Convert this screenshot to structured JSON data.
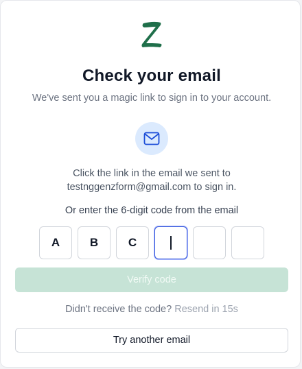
{
  "brand": {
    "logo_icon": "z-logo-icon",
    "logo_color": "#1f6f4a"
  },
  "header": {
    "title": "Check your email",
    "subtitle": "We've sent you a magic link to sign in to your account."
  },
  "mail_icon": {
    "name": "mail-icon",
    "color": "#1d4ed8",
    "bg": "#dbeafe"
  },
  "instructions": {
    "line1": "Click the link in the email we sent to",
    "line2": "testnggenzform@gmail.com to sign in."
  },
  "code": {
    "label": "Or enter the 6-digit code from the email",
    "digits": [
      "A",
      "B",
      "C",
      "",
      "",
      ""
    ],
    "active_index": 3
  },
  "verify_button": {
    "label": "Verify code",
    "disabled": true,
    "color": "#c6e3d6"
  },
  "resend": {
    "prompt": "Didn't receive the code?",
    "link": "Resend in 15s"
  },
  "try_another": {
    "label": "Try another email"
  }
}
